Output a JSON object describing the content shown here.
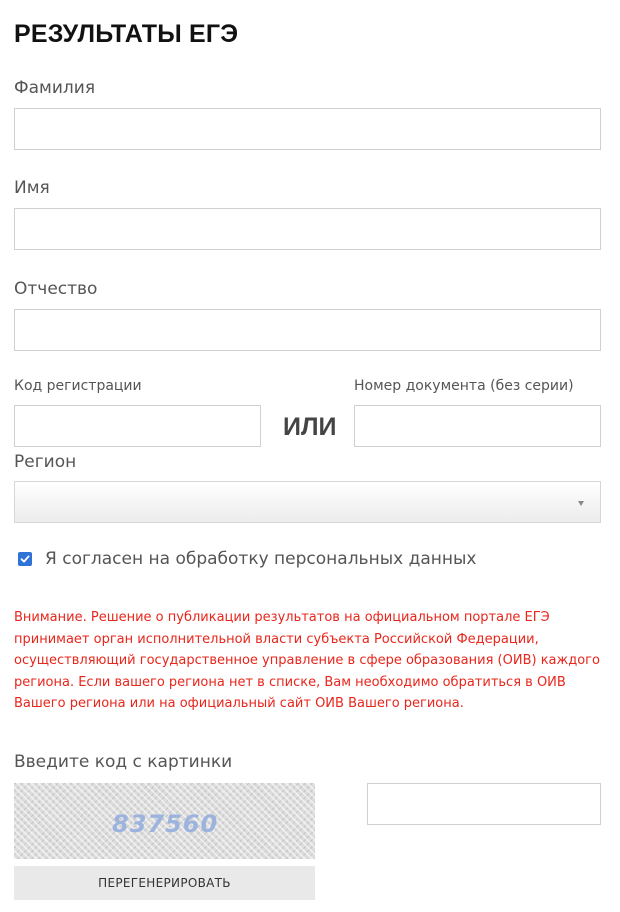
{
  "page": {
    "title": "РЕЗУЛЬТАТЫ ЕГЭ"
  },
  "form": {
    "surname": {
      "label": "Фамилия",
      "value": ""
    },
    "name": {
      "label": "Имя",
      "value": ""
    },
    "patronymic": {
      "label": "Отчество",
      "value": ""
    },
    "registration_code": {
      "label": "Код регистрации",
      "value": ""
    },
    "or_label": "ИЛИ",
    "document_number": {
      "label": "Номер документа (без серии)",
      "value": ""
    },
    "region": {
      "label": "Регион",
      "selected": ""
    },
    "consent": {
      "label": "Я согласен на обработку персональных данных",
      "checked": true
    },
    "warning": "Внимание. Решение о публикации результатов на официальном портале ЕГЭ принимает орган исполнительной власти субъекта Российской Федерации, осуществляющий государственное управление в сфере образования (ОИВ) каждого региона. Если вашего региона нет в списке, Вам необходимо обратиться в ОИВ Вашего региона или на официальный сайт ОИВ Вашего региона.",
    "captcha": {
      "label": "Введите код с картинки",
      "image_code": "837560",
      "input_value": "",
      "regenerate_label": "ПЕРЕГЕНЕРИРОВАТЬ"
    }
  },
  "colors": {
    "warning": "#e8261c",
    "checkbox": "#2f73d8",
    "captcha_text": "#9bb3dd"
  }
}
